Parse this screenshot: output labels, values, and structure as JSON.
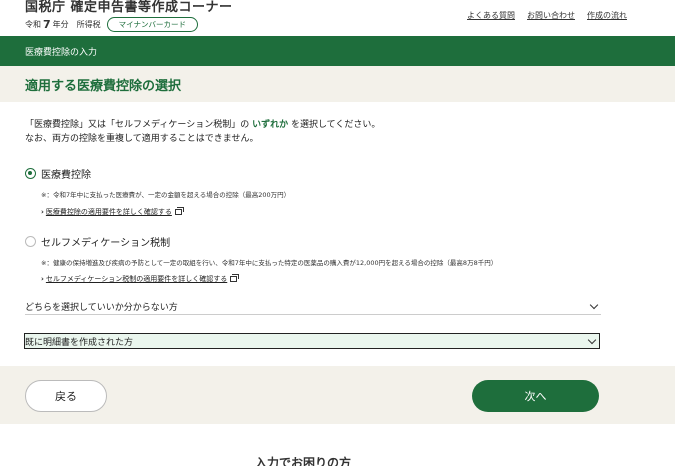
{
  "header": {
    "site_title": "国税庁 確定申告書等作成コーナー",
    "era": "令和",
    "year": "7",
    "year_suffix": "年分",
    "tax_type": "所得税",
    "mynumber_badge": "マイナンバーカード",
    "links": [
      "よくある質問",
      "お問い合わせ",
      "作成の流れ"
    ]
  },
  "breadcrumb": {
    "label": "医療費控除の入力"
  },
  "page": {
    "title": "適用する医療費控除の選択"
  },
  "intro": {
    "line1_prefix": "「医療費控除」又は「セルフメディケーション税制」の ",
    "line1_emph": "いずれか",
    "line1_suffix": " を選択してください。",
    "line2": "なお、両方の控除を重複して適用することはできません。"
  },
  "options": [
    {
      "label": "医療費控除",
      "selected": true,
      "note": "※：令和7年中に支払った医療費が、一定の金額を超える場合の控除（最高200万円）",
      "link": "医療費控除の適用要件を詳しく確認する"
    },
    {
      "label": "セルフメディケーション税制",
      "selected": false,
      "note": "※：健康の保持増進及び疾病の予防として一定の取組を行い、令和7年中に支払った特定の医薬品の購入費が12,000円を超える場合の控除（最高8万8千円）",
      "link": "セルフメディケーション税制の適用要件を詳しく確認する"
    }
  ],
  "accordions": [
    {
      "label": "どちらを選択していいか分からない方"
    },
    {
      "label": "既に明細書を作成された方"
    }
  ],
  "nav": {
    "back_label": "戻る",
    "next_label": "次へ"
  },
  "footer": {
    "heading": "入力でお困りの方"
  },
  "colors": {
    "brand_green": "#1e6e3c",
    "band_beige": "#f3f1ea",
    "accordion_highlight": "#eaf6ee"
  }
}
